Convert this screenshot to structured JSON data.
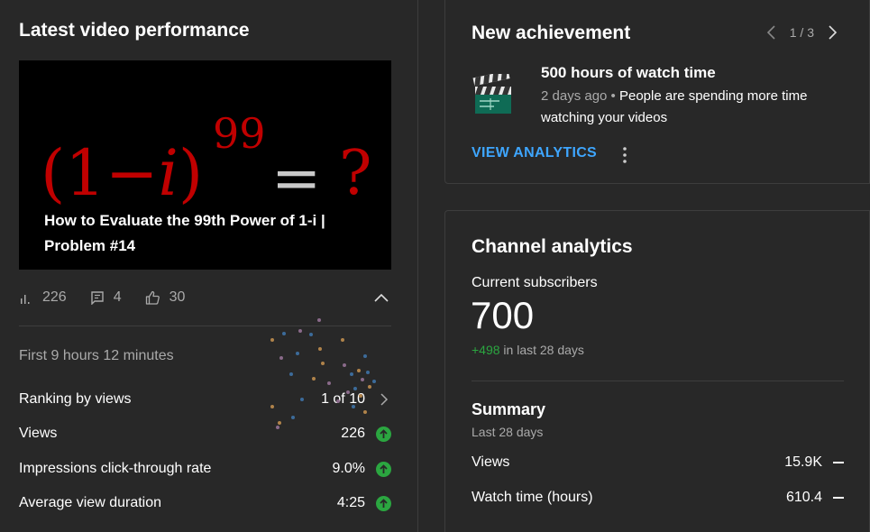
{
  "latest": {
    "title": "Latest video performance",
    "thumbnail": {
      "math_base": "(1−",
      "math_i": "i",
      "math_close": ")",
      "exponent": "99",
      "equals": "=",
      "question": "?",
      "video_title": "How to Evaluate the 99th Power of 1-i | Problem #14"
    },
    "stats": {
      "views": "226",
      "comments": "4",
      "likes": "30"
    },
    "first_hours": "First 9 hours 12 minutes",
    "metrics": [
      {
        "label": "Ranking by views",
        "value": "1 of 10"
      },
      {
        "label": "Views",
        "value": "226"
      },
      {
        "label": "Impressions click-through rate",
        "value": "9.0%"
      },
      {
        "label": "Average view duration",
        "value": "4:25"
      }
    ]
  },
  "achievement": {
    "title": "New achievement",
    "pager": "1 / 3",
    "name": "500 hours of watch time",
    "ago": "2 days ago",
    "separator": " • ",
    "description": "People are spending more time watching your videos",
    "action": "VIEW ANALYTICS"
  },
  "analytics": {
    "title": "Channel analytics",
    "current_subscribers_label": "Current subscribers",
    "subscribers": "700",
    "delta": "+498",
    "delta_suffix": " in last 28 days",
    "summary_title": "Summary",
    "summary_period": "Last 28 days",
    "rows": [
      {
        "label": "Views",
        "value": "15.9K"
      },
      {
        "label": "Watch time (hours)",
        "value": "610.4"
      }
    ]
  },
  "colors": {
    "background": "#282828",
    "accent_blue": "#3ea6ff",
    "positive_green": "#2ba640",
    "thumbnail_red": "#c00000",
    "muted_text": "#aaaaaa"
  },
  "icons": [
    "bar-chart-icon",
    "comment-icon",
    "thumbs-up-icon",
    "chevron-up-icon",
    "chevron-right-icon",
    "arrow-up-icon",
    "chevron-left-icon",
    "clapperboard-icon",
    "more-vert-icon"
  ]
}
